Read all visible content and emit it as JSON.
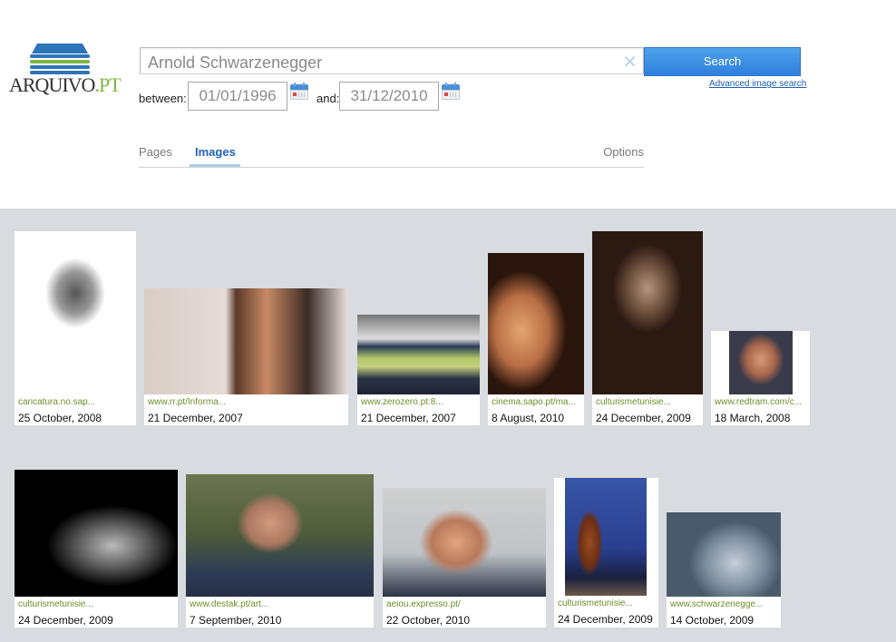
{
  "logo": {
    "name": "ARQUIVO",
    "suffix": ".PT"
  },
  "search": {
    "query": "Arnold Schwarzenegger",
    "clear_icon": "close-icon",
    "button_label": "Search",
    "advanced_link": "Advanced image search"
  },
  "date_range": {
    "from_label": "between:",
    "from_value": "01/01/1996",
    "to_label": "and:",
    "to_value": "31/12/2010",
    "calendar_icon": "calendar-icon"
  },
  "tabs": [
    {
      "label": "Pages",
      "active": false
    },
    {
      "label": "Images",
      "active": true
    },
    {
      "label": "Options",
      "active": false
    }
  ],
  "results": [
    {
      "source": "caricatura.no.sap...",
      "date": "25 October, 2008",
      "alt": "Caricature of a muscular bodybuilder flexing"
    },
    {
      "source": "www.rr.pt/Informa...",
      "date": "21 December, 2007",
      "alt": "Smiling man in suit at microphone"
    },
    {
      "source": "www.zerozero.pt:8...",
      "date": "21 December, 2007",
      "alt": "Football stadium interior"
    },
    {
      "source": "cinema.sapo.pt/ma...",
      "date": "8 August, 2010",
      "alt": "Close-up face portrait"
    },
    {
      "source": "culturismetunisie...",
      "date": "24 December, 2009",
      "alt": "Sepia photo of a young boy"
    },
    {
      "source": "www.redtram.com/c...",
      "date": "18 March, 2008",
      "alt": "Portrait of man in suit"
    },
    {
      "source": "culturismetunisie...",
      "date": "24 December, 2009",
      "alt": "Black and white bodybuilder pose"
    },
    {
      "source": "www.destak.pt/art...",
      "date": "7 September, 2010",
      "alt": "Man in profile outdoors"
    },
    {
      "source": "aeiou.expresso.pt/",
      "date": "22 October, 2010",
      "alt": "Man with surprised expression"
    },
    {
      "source": "culturismetunisie...",
      "date": "24 December, 2009",
      "alt": "Bodybuilder on stage with presenter"
    },
    {
      "source": "www.schwarzenegge...",
      "date": "14 October, 2009",
      "alt": "Stylized blue-tinted face portrait"
    }
  ]
}
